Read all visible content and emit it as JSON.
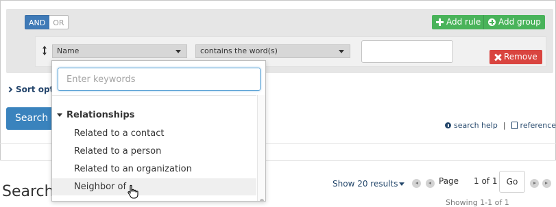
{
  "query_builder": {
    "conditions": {
      "and_label": "AND",
      "or_label": "OR"
    },
    "add_rule_label": "Add rule",
    "add_group_label": "Add group",
    "remove_label": "Remove",
    "rule": {
      "field_selected": "Name",
      "operator_selected": "contains the word(s)",
      "value": ""
    }
  },
  "dropdown": {
    "search_placeholder": "Enter keywords",
    "group_label": "Relationships",
    "options": [
      "Related to a contact",
      "Related to a person",
      "Related to an organization",
      "Neighbor of"
    ]
  },
  "sort_options_label": "Sort opti",
  "search_button_label": "Search",
  "help_links": {
    "search_help": "search help",
    "separator": "|",
    "reference": "reference"
  },
  "results": {
    "heading": "Search",
    "show_results_label": "Show 20 results",
    "page_label": "Page",
    "page_count": "1 of 1",
    "go_label": "Go",
    "showing_text": "Showing 1-1 of 1"
  },
  "colors": {
    "primary_blue": "#3a83bd",
    "green": "#49b35a",
    "red": "#d9443f",
    "link": "#24476b"
  }
}
